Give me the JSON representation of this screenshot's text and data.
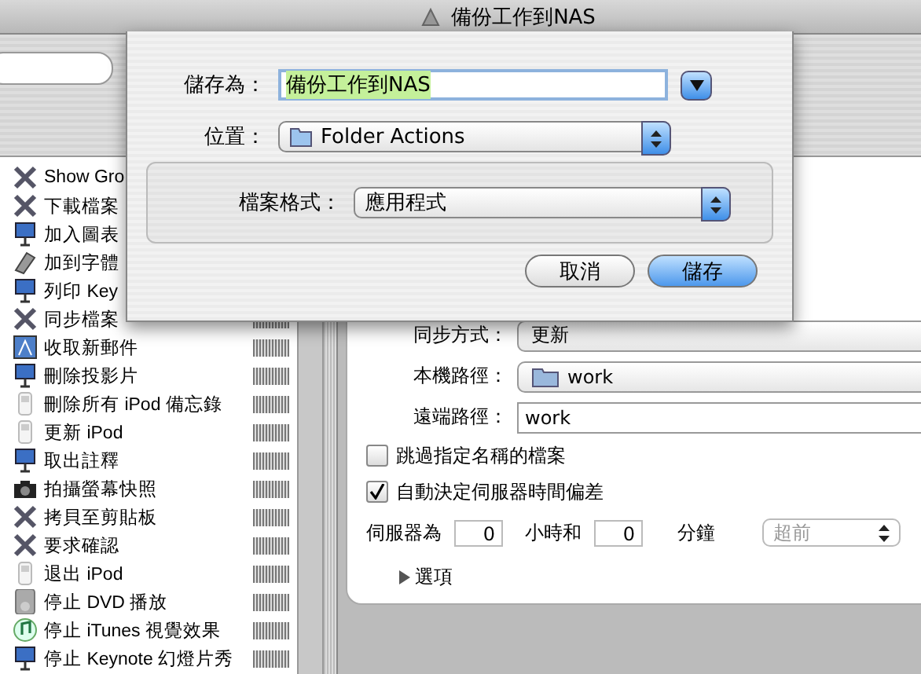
{
  "window": {
    "title": "備份工作到NAS"
  },
  "actions": [
    {
      "label": "Show Gro",
      "kind": "tool"
    },
    {
      "label": "下載檔案",
      "kind": "tool"
    },
    {
      "label": "加入圖表",
      "kind": "keynote"
    },
    {
      "label": "加到字體",
      "kind": "font"
    },
    {
      "label": "列印 Key",
      "kind": "keynote"
    },
    {
      "label": "同步檔案",
      "kind": "tool"
    },
    {
      "label": "收取新郵件",
      "kind": "mail"
    },
    {
      "label": "刪除投影片",
      "kind": "keynote"
    },
    {
      "label": "刪除所有 iPod 備忘錄",
      "kind": "ipod"
    },
    {
      "label": "更新 iPod",
      "kind": "ipod"
    },
    {
      "label": "取出註釋",
      "kind": "keynote"
    },
    {
      "label": "拍攝螢幕快照",
      "kind": "camera"
    },
    {
      "label": "拷貝至剪貼板",
      "kind": "tool"
    },
    {
      "label": "要求確認",
      "kind": "tool"
    },
    {
      "label": "退出 iPod",
      "kind": "ipod"
    },
    {
      "label": "停止 DVD 播放",
      "kind": "dvd"
    },
    {
      "label": "停止 iTunes 視覺效果",
      "kind": "itunes"
    },
    {
      "label": "停止 Keynote 幻燈片秀",
      "kind": "keynote"
    }
  ],
  "save_sheet": {
    "save_as_label": "儲存為：",
    "save_as_value": "備份工作到NAS",
    "text_selected": true,
    "location_label": "位置：",
    "location": "Folder Actions",
    "format_label": "檔案格式：",
    "format": "應用程式",
    "buttons": [
      {
        "label": "取消",
        "default": false
      },
      {
        "label": "儲存",
        "default": true
      }
    ]
  },
  "settings": {
    "fields": [
      {
        "label": "同步方式：",
        "value": "更新",
        "kind": "popup"
      },
      {
        "label": "本機路徑：",
        "value": "work",
        "kind": "folder"
      },
      {
        "label": "遠端路徑：",
        "value": "work",
        "kind": "text"
      }
    ],
    "checkboxes": [
      {
        "label": "跳過指定名稱的檔案",
        "checked": false
      },
      {
        "label": "自動決定伺服器時間偏差",
        "checked": true
      }
    ],
    "offset": {
      "label": "伺服器為",
      "hours": "0",
      "hours_label": "小時和",
      "minutes": "0",
      "minutes_label": "分鐘",
      "direction": "超前",
      "direction_disabled": true
    },
    "options": {
      "label": "選項",
      "expanded": false
    }
  }
}
